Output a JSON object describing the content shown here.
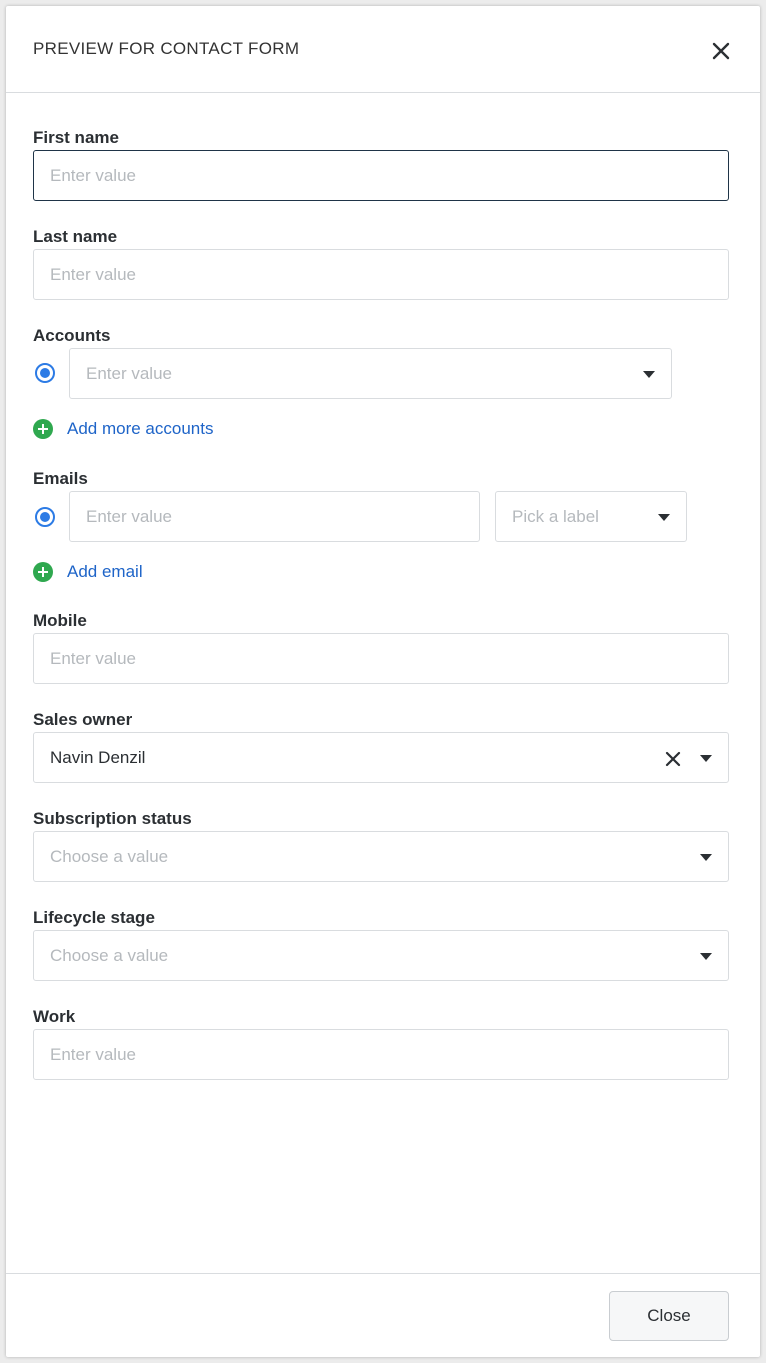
{
  "header": {
    "title": "PREVIEW FOR CONTACT FORM"
  },
  "fields": {
    "first_name": {
      "label": "First name",
      "placeholder": "Enter value"
    },
    "last_name": {
      "label": "Last name",
      "placeholder": "Enter value"
    },
    "accounts": {
      "label": "Accounts",
      "placeholder": "Enter value",
      "add_label": "Add more accounts"
    },
    "emails": {
      "label": "Emails",
      "placeholder": "Enter value",
      "label_placeholder": "Pick a label",
      "add_label": "Add email"
    },
    "mobile": {
      "label": "Mobile",
      "placeholder": "Enter value"
    },
    "sales_owner": {
      "label": "Sales owner",
      "value": "Navin Denzil"
    },
    "subscription_status": {
      "label": "Subscription status",
      "placeholder": "Choose a value"
    },
    "lifecycle_stage": {
      "label": "Lifecycle stage",
      "placeholder": "Choose a value"
    },
    "work": {
      "label": "Work",
      "placeholder": "Enter value"
    }
  },
  "footer": {
    "close_label": "Close"
  },
  "colors": {
    "accent_blue": "#2c7be5",
    "link_blue": "#1e64c8",
    "add_green": "#2fa84f",
    "focus_border": "#1f3447"
  }
}
